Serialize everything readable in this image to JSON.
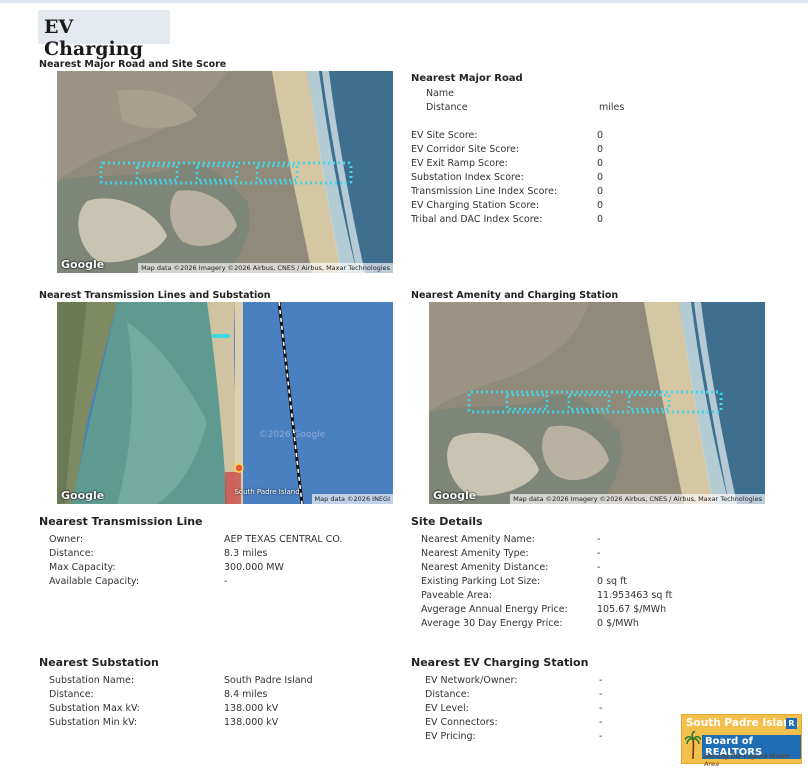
{
  "title": "EV Charging",
  "section1": {
    "caption": "Nearest Major Road and Site Score",
    "map": {
      "google": "Google",
      "attribution": "Map data ©2026 Imagery ©2026 Airbus, CNES / Airbus, Maxar Technologies"
    }
  },
  "major_road": {
    "heading": "Nearest Major Road",
    "name_label": "Name",
    "distance_label": "Distance",
    "distance_unit": "miles",
    "scores": [
      {
        "label": "EV Site Score:",
        "value": "0"
      },
      {
        "label": "EV Corridor Site Score:",
        "value": "0"
      },
      {
        "label": "EV Exit Ramp Score:",
        "value": "0"
      },
      {
        "label": "Substation Index Score:",
        "value": "0"
      },
      {
        "label": "Transmission Line Index Score:",
        "value": "0"
      },
      {
        "label": "EV Charging Station Score:",
        "value": "0"
      },
      {
        "label": "Tribal and DAC Index Score:",
        "value": "0"
      }
    ]
  },
  "section2": {
    "caption": "Nearest Transmission Lines and Substation",
    "map": {
      "google": "Google",
      "attribution": "Map data ©2026 INEGI",
      "place": "South Padre Island",
      "watermark": "©2026 Google"
    }
  },
  "section3": {
    "caption": "Nearest Amenity and Charging Station",
    "map": {
      "google": "Google",
      "attribution": "Map data ©2026 Imagery ©2026 Airbus, CNES / Airbus, Maxar Technologies"
    }
  },
  "transmission": {
    "heading": "Nearest Transmission Line",
    "rows": [
      {
        "label": "Owner:",
        "value": "AEP TEXAS CENTRAL CO."
      },
      {
        "label": "Distance:",
        "value": "8.3 miles"
      },
      {
        "label": "Max Capacity:",
        "value": "300.000 MW"
      },
      {
        "label": "Available Capacity:",
        "value": "-"
      }
    ]
  },
  "site_details": {
    "heading": "Site Details",
    "rows": [
      {
        "label": "Nearest Amenity Name:",
        "value": "-"
      },
      {
        "label": "Nearest Amenity Type:",
        "value": "-"
      },
      {
        "label": "Nearest Amenity Distance:",
        "value": "-"
      },
      {
        "label": "Existing Parking Lot Size:",
        "value": "0 sq ft"
      },
      {
        "label": "Paveable Area:",
        "value": "11.953463 sq ft"
      },
      {
        "label": "Avgerage Annual Energy Price:",
        "value": "105.67 $/MWh"
      },
      {
        "label": "Average 30 Day Energy Price:",
        "value": "0 $/MWh"
      }
    ]
  },
  "substation": {
    "heading": "Nearest Substation",
    "rows": [
      {
        "label": "Substation Name:",
        "value": "South Padre Island"
      },
      {
        "label": "Distance:",
        "value": "8.4 miles"
      },
      {
        "label": "Substation Max kV:",
        "value": "138.000 kV"
      },
      {
        "label": "Substation Min kV:",
        "value": "138.000 kV"
      }
    ]
  },
  "ev_station": {
    "heading": "Nearest EV Charging Station",
    "rows": [
      {
        "label": "EV Network/Owner:",
        "value": "-"
      },
      {
        "label": "Distance:",
        "value": "-"
      },
      {
        "label": "EV Level:",
        "value": "-"
      },
      {
        "label": "EV Connectors:",
        "value": "-"
      },
      {
        "label": "EV Pricing:",
        "value": "-"
      }
    ]
  },
  "logo": {
    "line1": "South Padre Island",
    "line2": "Board of REALTORS",
    "line3": "Serving the Laguna Madre Area",
    "badge": "R"
  },
  "colors": {
    "water_deep": "#4a7fc0",
    "lagoon": "#5f9a90",
    "sand": "#c9b99a",
    "route": "#3fd6e6"
  }
}
